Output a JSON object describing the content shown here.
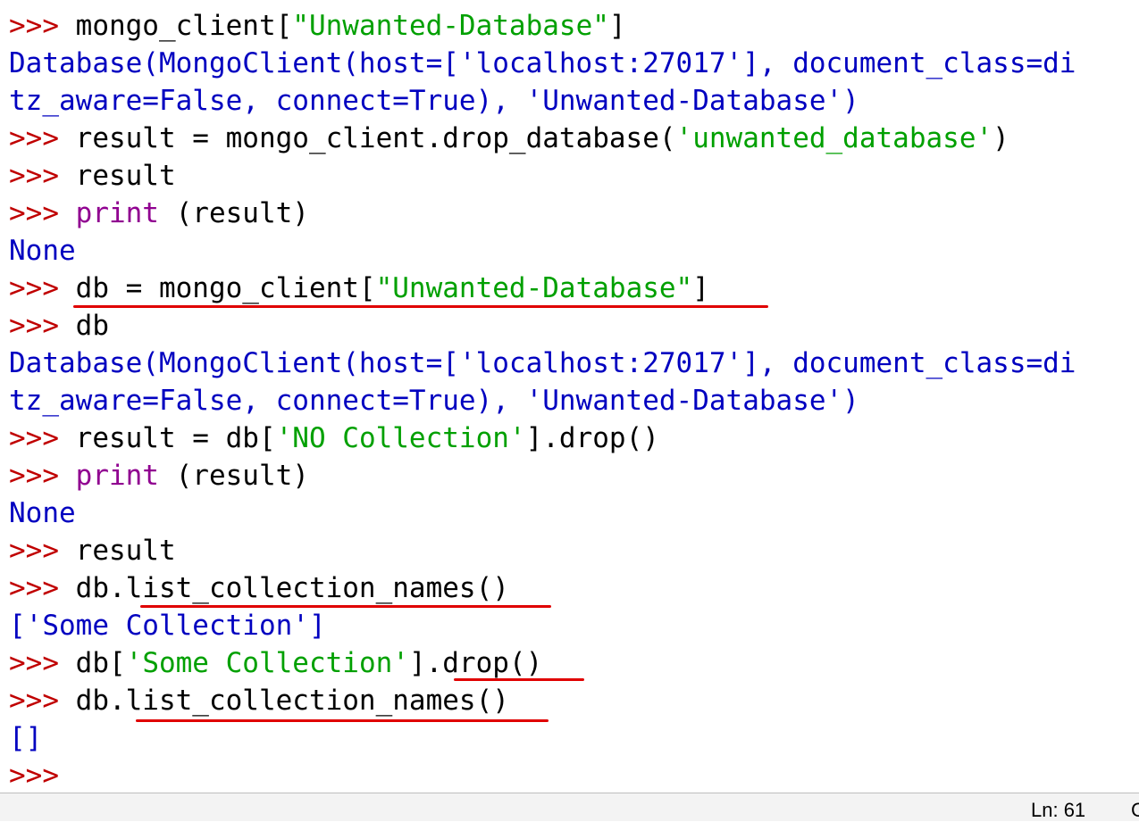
{
  "shell": {
    "prompt": ">>> ",
    "lines": [
      {
        "type": "input",
        "parts": [
          {
            "c": "code",
            "t": "mongo_client["
          },
          {
            "c": "str",
            "t": "\"Unwanted-Database\""
          },
          {
            "c": "code",
            "t": "]"
          }
        ]
      },
      {
        "type": "output",
        "parts": [
          {
            "c": "out",
            "t": "Database(MongoClient(host=['localhost:27017'], document_class=di"
          }
        ]
      },
      {
        "type": "output",
        "parts": [
          {
            "c": "out",
            "t": "tz_aware=False, connect=True), 'Unwanted-Database')"
          }
        ]
      },
      {
        "type": "input",
        "parts": [
          {
            "c": "code",
            "t": "result = mongo_client.drop_database("
          },
          {
            "c": "str",
            "t": "'unwanted_database'"
          },
          {
            "c": "code",
            "t": ")"
          }
        ]
      },
      {
        "type": "input",
        "parts": [
          {
            "c": "code",
            "t": "result"
          }
        ]
      },
      {
        "type": "input",
        "parts": [
          {
            "c": "kw",
            "t": "print"
          },
          {
            "c": "code",
            "t": " (result)"
          }
        ]
      },
      {
        "type": "output",
        "parts": [
          {
            "c": "out",
            "t": "None"
          }
        ]
      },
      {
        "type": "input",
        "parts": [
          {
            "c": "code",
            "t": "db = mongo_client["
          },
          {
            "c": "str",
            "t": "\"Unwanted-Database\""
          },
          {
            "c": "code",
            "t": "]"
          }
        ]
      },
      {
        "type": "input",
        "parts": [
          {
            "c": "code",
            "t": "db"
          }
        ]
      },
      {
        "type": "output",
        "parts": [
          {
            "c": "out",
            "t": "Database(MongoClient(host=['localhost:27017'], document_class=di"
          }
        ]
      },
      {
        "type": "output",
        "parts": [
          {
            "c": "out",
            "t": "tz_aware=False, connect=True), 'Unwanted-Database')"
          }
        ]
      },
      {
        "type": "input",
        "parts": [
          {
            "c": "code",
            "t": "result = db["
          },
          {
            "c": "str",
            "t": "'NO Collection'"
          },
          {
            "c": "code",
            "t": "].drop()"
          }
        ]
      },
      {
        "type": "input",
        "parts": [
          {
            "c": "kw",
            "t": "print"
          },
          {
            "c": "code",
            "t": " (result)"
          }
        ]
      },
      {
        "type": "output",
        "parts": [
          {
            "c": "out",
            "t": "None"
          }
        ]
      },
      {
        "type": "input",
        "parts": [
          {
            "c": "code",
            "t": "result"
          }
        ]
      },
      {
        "type": "input",
        "parts": [
          {
            "c": "code",
            "t": "db.list_collection_names()"
          }
        ]
      },
      {
        "type": "output",
        "parts": [
          {
            "c": "out",
            "t": "['Some Collection']"
          }
        ]
      },
      {
        "type": "input",
        "parts": [
          {
            "c": "code",
            "t": "db["
          },
          {
            "c": "str",
            "t": "'Some Collection'"
          },
          {
            "c": "code",
            "t": "].drop()"
          }
        ]
      },
      {
        "type": "input",
        "parts": [
          {
            "c": "code",
            "t": "db.list_collection_names()"
          }
        ]
      },
      {
        "type": "output",
        "parts": [
          {
            "c": "out",
            "t": "[]"
          }
        ]
      },
      {
        "type": "input",
        "parts": []
      }
    ]
  },
  "status_bar": {
    "line_label": "Ln: 61",
    "col_label": "C"
  },
  "colors": {
    "prompt": "#c00000",
    "keyword": "#900090",
    "string": "#00a000",
    "output": "#0000c0",
    "highlight": "#e00000"
  }
}
